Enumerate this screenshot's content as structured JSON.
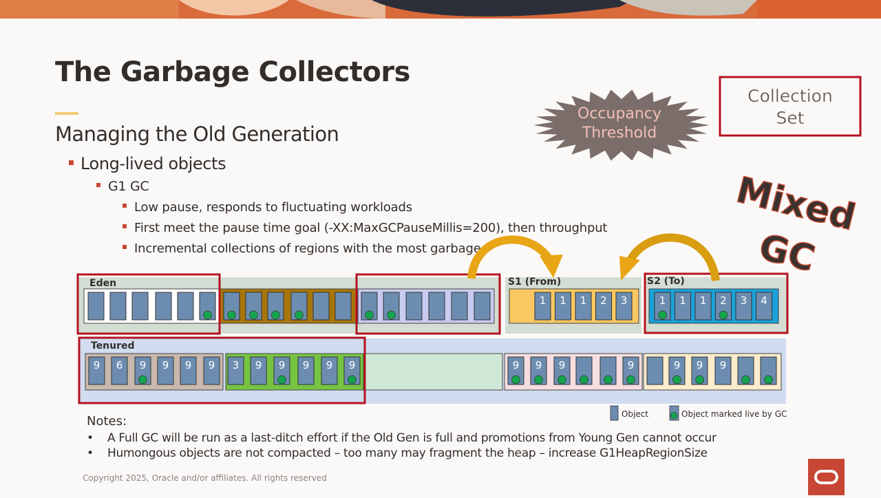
{
  "slide": {
    "title": "The Garbage Collectors",
    "subtitle": "Managing the Old Generation",
    "bullet1": "Long-lived objects",
    "bullet2": "G1 GC",
    "bullet3": [
      "Low pause, responds to fluctuating  workloads",
      "First meet the pause time goal (-XX:MaxGCPauseMillis=200), then throughput",
      "Incremental collections of regions with the most garbage"
    ]
  },
  "diagram": {
    "callout": "Occupancy Threshold",
    "callout_line1": "Occupancy",
    "callout_line2": "Threshold",
    "collection_set_line1": "Collection",
    "collection_set_line2": "Set",
    "mixed_line1": "Mixed",
    "mixed_line2": "GC",
    "eden_label": "Eden",
    "s1_label": "S1 (From)",
    "s2_label": "S2 (To)",
    "tenured_label": "Tenured",
    "s1_values": [
      "1",
      "1",
      "1",
      "2",
      "3"
    ],
    "s2_values": [
      "1",
      "1",
      "1",
      "2",
      "3",
      "4"
    ],
    "tenured_values": {
      "region1": [
        "9",
        "6",
        "9",
        "9",
        "9",
        "9"
      ],
      "region2": [
        "3",
        "9",
        "9",
        "9",
        "9",
        "9"
      ],
      "region4": [
        "9",
        "9",
        "9",
        "",
        "",
        "9"
      ],
      "region5": [
        "",
        "9",
        "9",
        "9",
        "",
        ""
      ]
    },
    "legend_object": "Object",
    "legend_live": "Object marked live by GC",
    "colors": {
      "highlight": "#b3131f",
      "object": "#6d8db0",
      "live_marker": "#14a44d",
      "arrow": "#e8a515",
      "cyan_region": "#1aa1d8",
      "brown_region": "#a7760b",
      "green_region": "#76c442",
      "lavender_region": "#c9cbf0",
      "yellow_region": "#fac862",
      "starburst": "#7b6d69"
    }
  },
  "notes": {
    "heading": "Notes:",
    "bullet_symbol": "•",
    "items": [
      "A Full GC will be run as a last-ditch effort if the Old Gen is full and promotions from Young Gen cannot occur",
      "Humongous objects are not compacted – too many may fragment the heap – increase G1HeapRegionSize"
    ]
  },
  "footer": {
    "copyright": "Copyright 2025, Oracle and/or affiliates. All rights reserved"
  }
}
